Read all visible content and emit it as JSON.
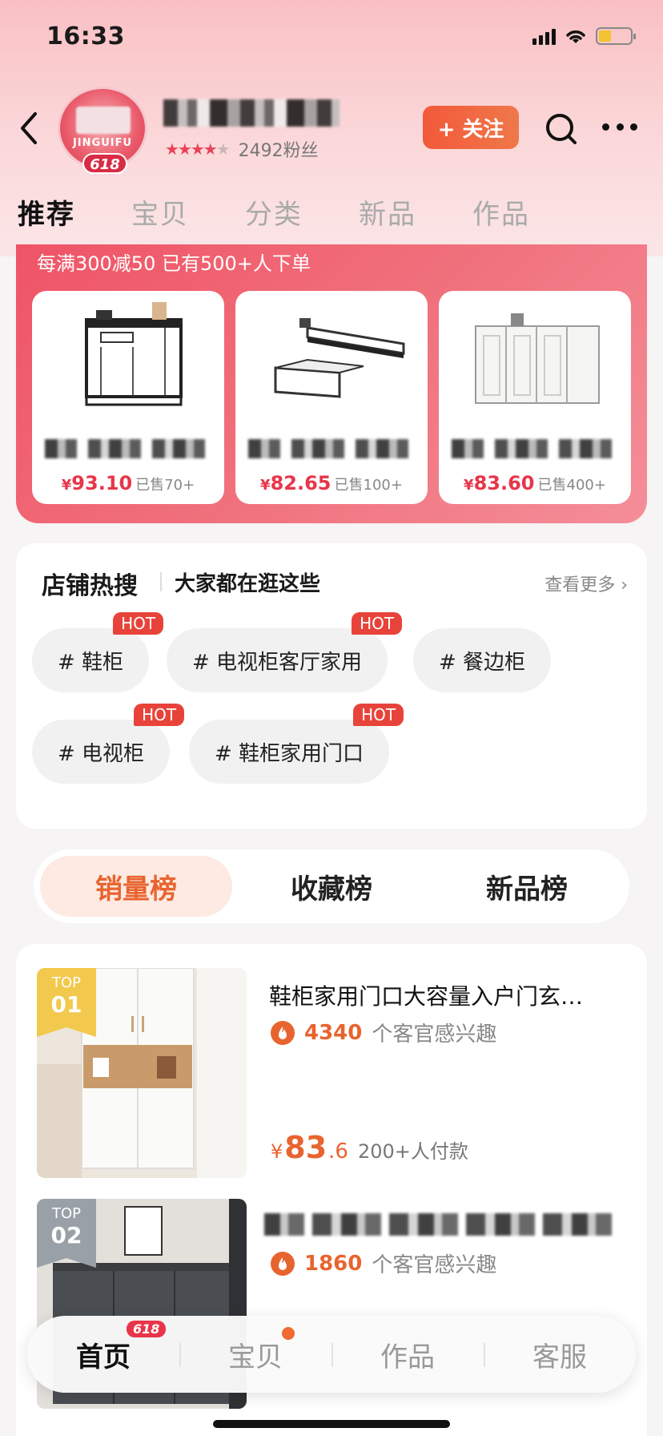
{
  "status_bar": {
    "time": "16:33"
  },
  "header": {
    "avatar_text": "JINGUIFU",
    "avatar_badge": "618",
    "fans": "2492粉丝",
    "follow_label": "+ 关注"
  },
  "nav_tabs": [
    {
      "label": "推荐",
      "active": true
    },
    {
      "label": "宝贝",
      "active": false
    },
    {
      "label": "分类",
      "active": false
    },
    {
      "label": "新品",
      "active": false
    },
    {
      "label": "作品",
      "active": false
    }
  ],
  "promo": {
    "title": "每满300减50 已有500+人下单",
    "items": [
      {
        "currency": "¥",
        "price": "93.10",
        "sold": "已售70+"
      },
      {
        "currency": "¥",
        "price": "82.65",
        "sold": "已售100+"
      },
      {
        "currency": "¥",
        "price": "83.60",
        "sold": "已售400+"
      }
    ]
  },
  "hot_search": {
    "title": "店铺热搜",
    "subtitle": "大家都在逛这些",
    "more": "查看更多 ›",
    "hot_label": "HOT",
    "tags": [
      {
        "label": "# 鞋柜",
        "hot": true
      },
      {
        "label": "# 电视柜客厅家用",
        "hot": true
      },
      {
        "label": "# 餐边柜",
        "hot": false
      },
      {
        "label": "# 电视柜",
        "hot": true
      },
      {
        "label": "# 鞋柜家用门口",
        "hot": true
      }
    ]
  },
  "rank_tabs": [
    {
      "label": "销量榜",
      "active": true
    },
    {
      "label": "收藏榜",
      "active": false
    },
    {
      "label": "新品榜",
      "active": false
    }
  ],
  "products": [
    {
      "top_label": "TOP",
      "rank": "01",
      "title": "鞋柜家用门口大容量入户门玄…",
      "interest_count": "4340",
      "interest_text": "个客官感兴趣",
      "currency": "¥",
      "price_int": "83",
      "price_dec": ".6",
      "paid": "200+人付款"
    },
    {
      "top_label": "TOP",
      "rank": "02",
      "title": "",
      "interest_count": "1860",
      "interest_text": "个客官感兴趣"
    }
  ],
  "bottom_nav": {
    "badge": "618",
    "items": [
      {
        "label": "首页",
        "active": true
      },
      {
        "label": "宝贝",
        "active": false
      },
      {
        "label": "作品",
        "active": false
      },
      {
        "label": "客服",
        "active": false
      }
    ]
  },
  "colors": {
    "accent": "#e8642f",
    "promo_red": "#ef5466",
    "hot_red": "#e8433a",
    "rank1_gold": "#f2c94c",
    "rank2_gray": "#9aa0a8"
  },
  "icons": [
    "back-icon",
    "search-icon",
    "more-icon",
    "fire-icon",
    "signal-icon",
    "wifi-icon",
    "battery-icon"
  ]
}
